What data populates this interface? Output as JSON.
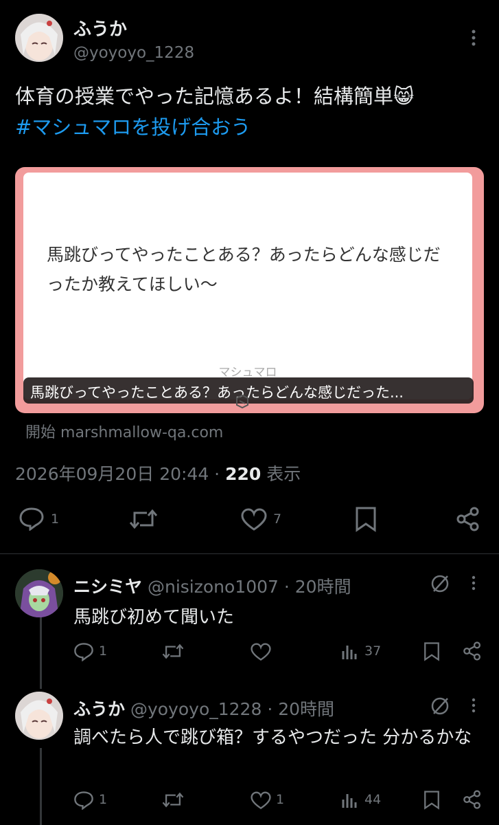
{
  "main_tweet": {
    "display_name": "ふうか",
    "handle": "@yoyoyo_1228",
    "text_line1": "体育の授業でやった記憶あるよ！結構簡単😸",
    "hashtag": "#マシュマロを投げ合おう",
    "card": {
      "question": "馬跳びってやったことある？あったらどんな感じだったか教えてほしい〜",
      "brand": "マシュマロ",
      "caption": "馬跳びってやったことある？あったらどんな感じだった..."
    },
    "source_prefix": "開始",
    "source_domain": "marshmallow-qa.com",
    "timestamp": "2026年09月20日 20:44 · ",
    "view_count": "220",
    "view_label": " 表示",
    "actions": {
      "reply_count": "1",
      "like_count": "7"
    }
  },
  "replies": [
    {
      "display_name": "ニシミヤ",
      "handle": "@nisizono1007",
      "time": "· 20時間",
      "text": "馬跳び初めて聞いた",
      "reply_count": "1",
      "like_count": "",
      "view_count": "37"
    },
    {
      "display_name": "ふうか",
      "handle": "@yoyoyo_1228",
      "time": "· 20時間",
      "text": "調べたら人で跳び箱？するやつだった 分かるかな",
      "reply_count": "1",
      "like_count": "1",
      "view_count": "44"
    }
  ],
  "colors": {
    "accent": "#1d9bf0",
    "card_border": "#f29c9c",
    "muted": "#71767b"
  }
}
